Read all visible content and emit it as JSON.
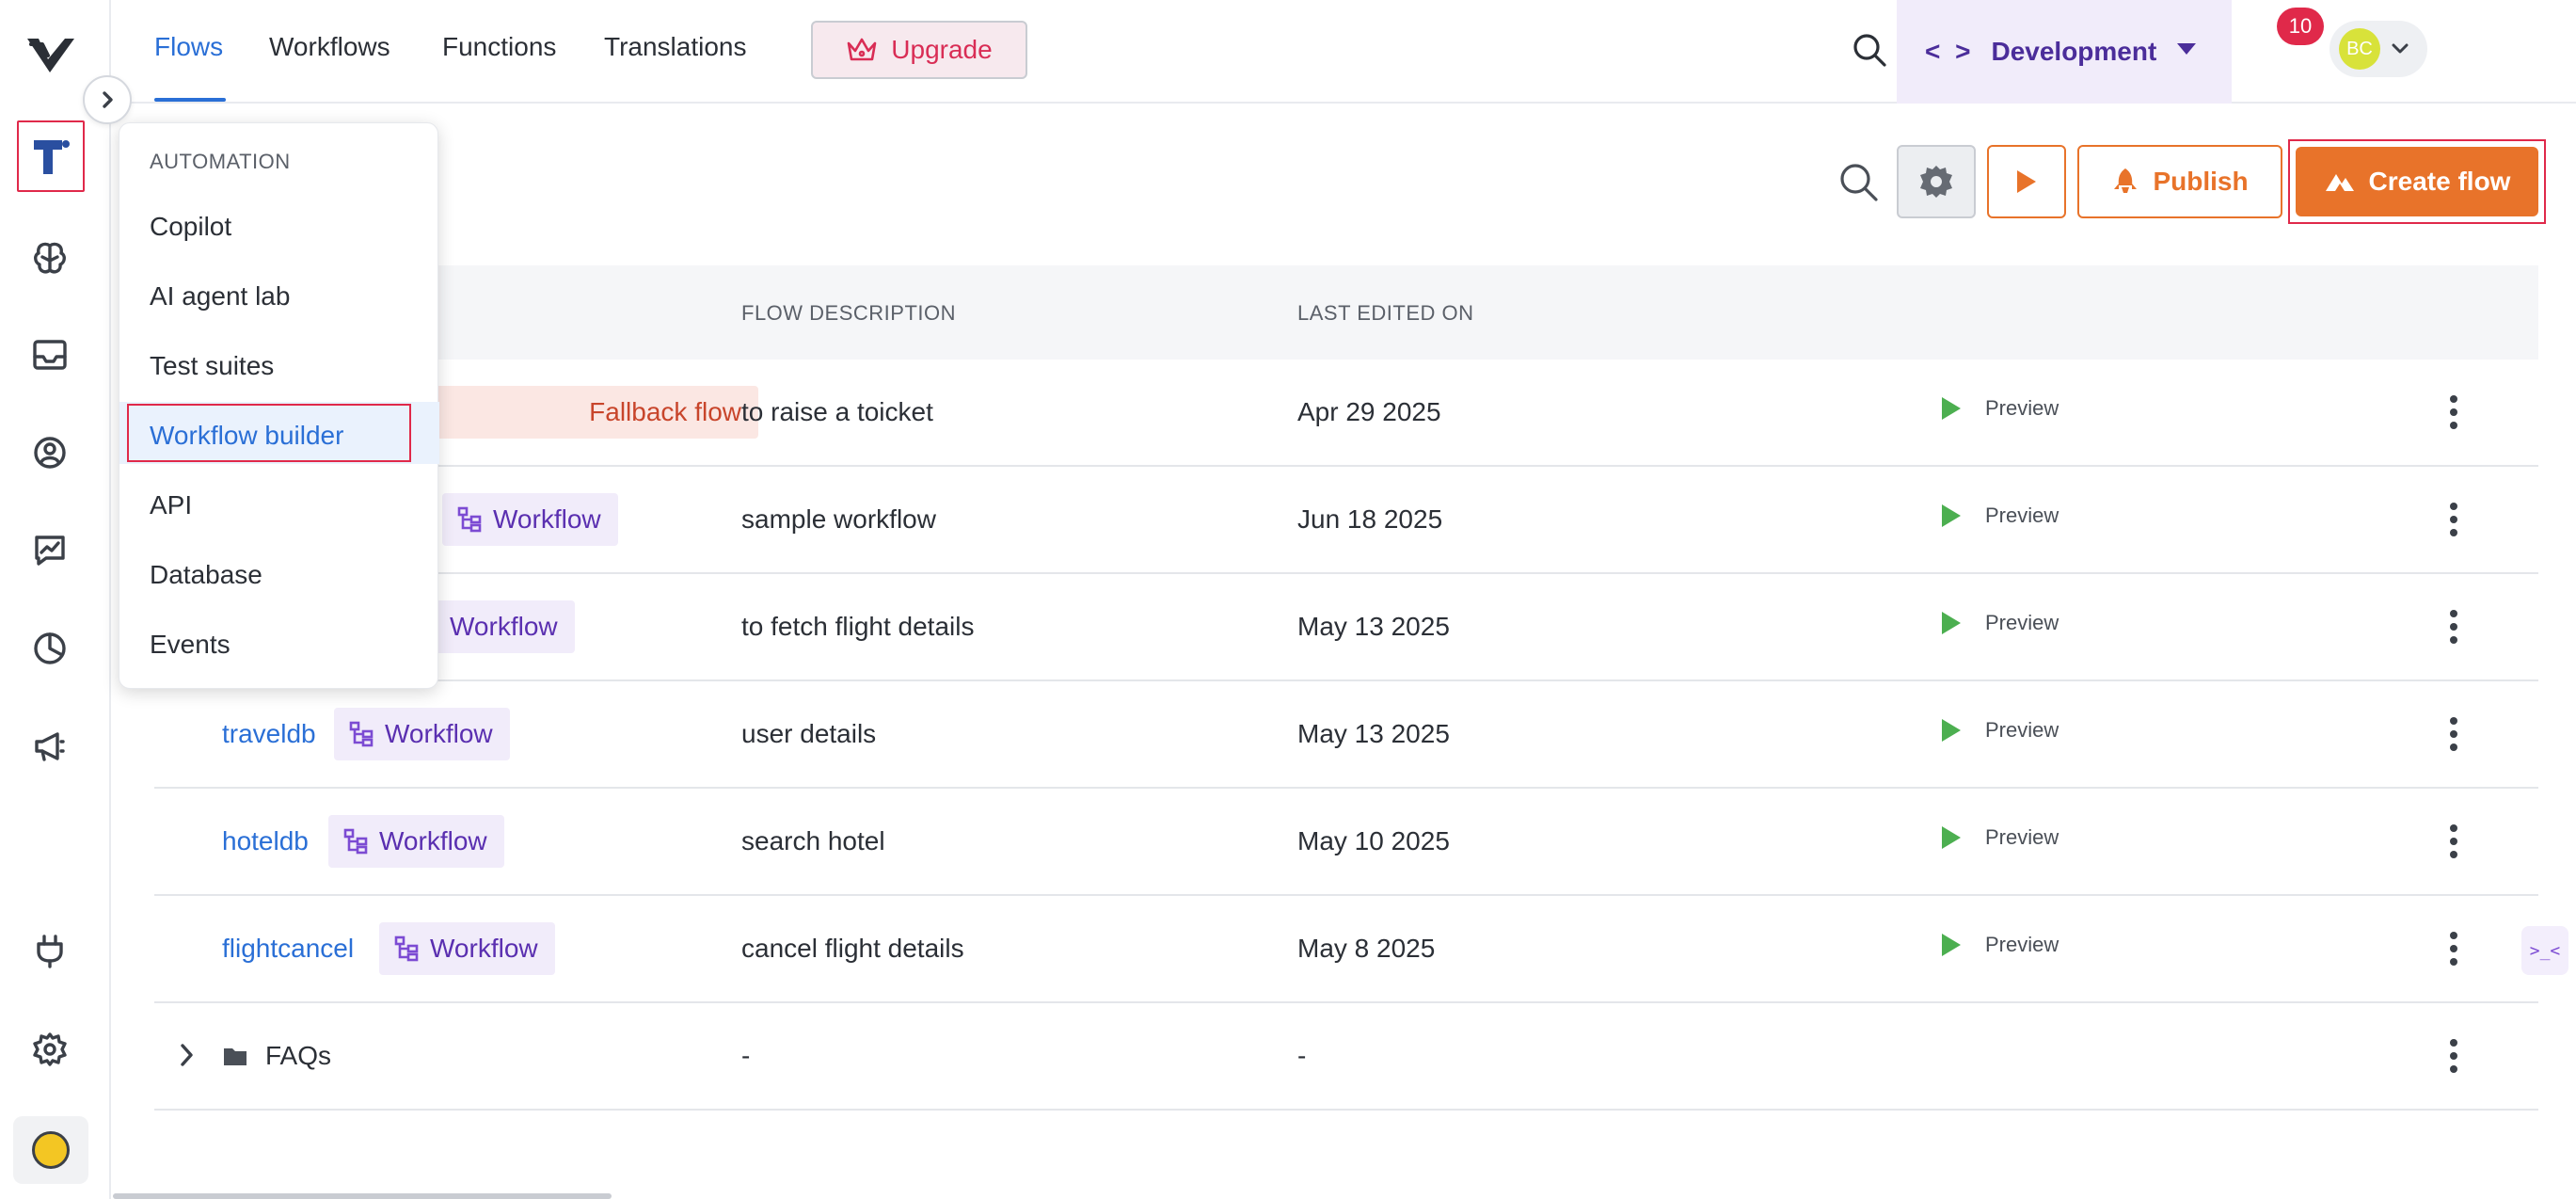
{
  "nav": {
    "tabs": [
      {
        "label": "Flows",
        "active": true
      },
      {
        "label": "Workflows"
      },
      {
        "label": "Functions"
      },
      {
        "label": "Translations"
      }
    ],
    "upgrade_label": "Upgrade",
    "environment": "Development",
    "notification_count": "10",
    "user_initials": "BC"
  },
  "toolbar": {
    "publish_label": "Publish",
    "create_label": "Create flow"
  },
  "menu": {
    "section": "AUTOMATION",
    "items": [
      "Copilot",
      "AI agent lab",
      "Test suites",
      "Workflow builder",
      "API",
      "Database",
      "Events"
    ],
    "selected": "Workflow builder"
  },
  "table": {
    "headers": {
      "description": "FLOW DESCRIPTION",
      "edited": "LAST EDITED ON"
    },
    "rows": [
      {
        "name": "",
        "tag": "Fallback flow",
        "description": "to raise a toicket",
        "edited": "Apr 29 2025",
        "action": "Preview"
      },
      {
        "name": "",
        "tag": "Workflow",
        "description": "sample workflow",
        "edited": "Jun 18 2025",
        "action": "Preview"
      },
      {
        "name": "",
        "tag": "Workflow",
        "description": "to fetch flight details",
        "edited": "May 13 2025",
        "action": "Preview"
      },
      {
        "name": "traveldb",
        "tag": "Workflow",
        "description": "user details",
        "edited": "May 13 2025",
        "action": "Preview"
      },
      {
        "name": "hoteldb",
        "tag": "Workflow",
        "description": "search hotel",
        "edited": "May 10 2025",
        "action": "Preview"
      },
      {
        "name": "flightcancel",
        "tag": "Workflow",
        "description": "cancel flight details",
        "edited": "May 8 2025",
        "action": "Preview"
      }
    ],
    "folder": {
      "name": "FAQs",
      "description": "-",
      "edited": "-"
    }
  },
  "float_button_label": ">_<",
  "colors": {
    "accent_blue": "#2a6fd6",
    "brand_orange": "#e8732a",
    "highlight_red": "#e0294a",
    "workflow_purple": "#5a2fb0",
    "preview_green": "#4caf50"
  },
  "icons": {
    "rail": [
      "logo-icon",
      "flows-icon",
      "brain-icon",
      "inbox-icon",
      "users-icon",
      "analytics-icon",
      "pie-chart-icon",
      "megaphone-icon",
      "plugin-icon",
      "settings-icon",
      "bot-avatar-icon"
    ],
    "top": [
      "search-icon",
      "help-icon",
      "code-icon",
      "bell-icon",
      "chevron-down-icon"
    ],
    "toolbar": [
      "search-icon",
      "gear-icon",
      "play-icon",
      "rocket-icon",
      "flow-icon"
    ]
  }
}
